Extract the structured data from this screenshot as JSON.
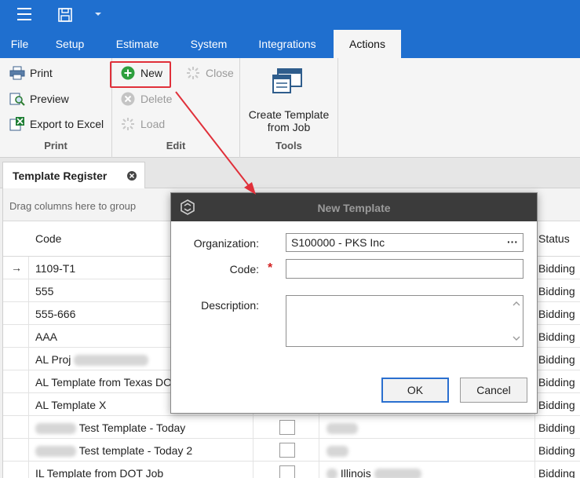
{
  "colors": {
    "accent": "#1f6fcf",
    "highlight": "#e0303a",
    "required": "#d21f1f",
    "new_icon": "#2e9f3e",
    "dialog_title_bg": "#3b3b3b"
  },
  "icons": {
    "menu": "hamburger-icon",
    "save": "save-icon",
    "quick_access": "chevron-down-icon"
  },
  "tabs": [
    {
      "label": "File",
      "active": false
    },
    {
      "label": "Setup",
      "active": false
    },
    {
      "label": "Estimate",
      "active": false
    },
    {
      "label": "System",
      "active": false
    },
    {
      "label": "Integrations",
      "active": false
    },
    {
      "label": "Actions",
      "active": true
    }
  ],
  "ribbon": {
    "print_group": {
      "label": "Print",
      "print": "Print",
      "preview": "Preview",
      "export": "Export to Excel"
    },
    "edit_group": {
      "label": "Edit",
      "new": "New",
      "close": "Close",
      "delete": "Delete",
      "load": "Load"
    },
    "tools_group": {
      "label": "Tools",
      "create_template": "Create Template from Job"
    }
  },
  "document_tab": {
    "label": "Template Register"
  },
  "grid": {
    "group_panel_text": "Drag columns here to group",
    "columns": {
      "code": "Code",
      "status": "Status"
    },
    "rows": [
      {
        "code": "1109-T1",
        "status": "Bidding",
        "current": true,
        "indicator": "→"
      },
      {
        "code": "555",
        "status": "Bidding"
      },
      {
        "code": "555-666",
        "status": "Bidding"
      },
      {
        "code": "AAA",
        "status": "Bidding"
      },
      {
        "code": "AL Proj",
        "status": "Bidding"
      },
      {
        "code": "AL Template from Texas DOT",
        "status": "Bidding"
      },
      {
        "code": "AL Template X",
        "status": "Bidding"
      },
      {
        "code": "Test Template - Today",
        "status": "Bidding"
      },
      {
        "code": "Test template - Today 2",
        "status": "Bidding"
      },
      {
        "code": "IL Template from DOT Job",
        "status": "Bidding",
        "organization": "Illinois"
      }
    ]
  },
  "dialog": {
    "title": "New Template",
    "organization_label": "Organization:",
    "organization_value": "S100000 - PKS Inc",
    "organization_button": "···",
    "code_label": "Code:",
    "code_required": "*",
    "code_value": "",
    "description_label": "Description:",
    "description_value": "",
    "ok_label": "OK",
    "cancel_label": "Cancel"
  }
}
